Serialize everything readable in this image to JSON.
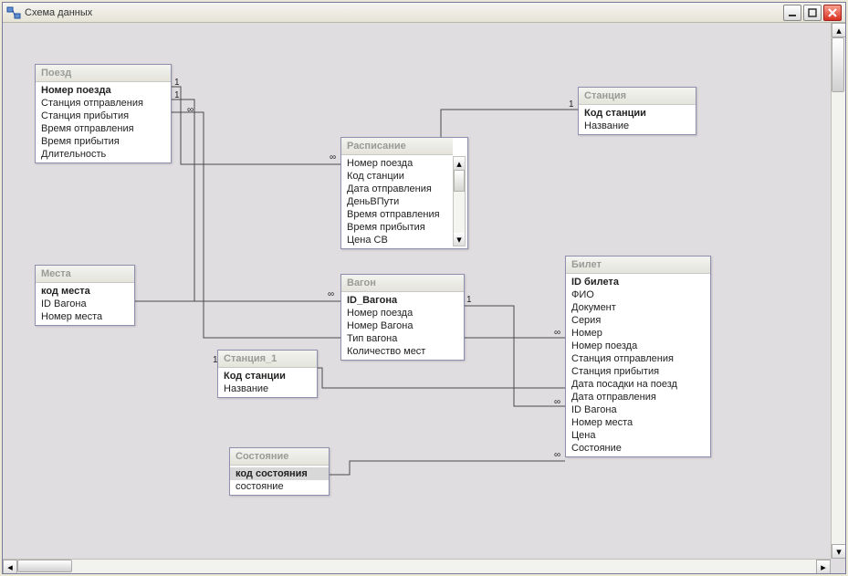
{
  "window": {
    "title": "Схема данных"
  },
  "tables": {
    "train": {
      "title": "Поезд",
      "fields": [
        "Номер поезда",
        "Станция отправления",
        "Станция прибытия",
        "Время отправления",
        "Время прибытия",
        "Длительность"
      ],
      "keys": [
        0
      ]
    },
    "station": {
      "title": "Станция",
      "fields": [
        "Код станции",
        "Название"
      ],
      "keys": [
        0
      ]
    },
    "schedule": {
      "title": "Расписание",
      "fields": [
        "Номер поезда",
        "Код станции",
        "Дата отправления",
        "ДеньВПути",
        "Время отправления",
        "Время прибытия",
        "Цена СВ"
      ],
      "keys": []
    },
    "seats": {
      "title": "Места",
      "fields": [
        "код места",
        "ID Вагона",
        "Номер места"
      ],
      "keys": [
        0
      ]
    },
    "wagon": {
      "title": "Вагон",
      "fields": [
        "ID_Вагона",
        "Номер поезда",
        "Номер Вагона",
        "Тип вагона",
        "Количество мест"
      ],
      "keys": [
        0
      ]
    },
    "station1": {
      "title": "Станция_1",
      "fields": [
        "Код станции",
        "Название"
      ],
      "keys": [
        0
      ]
    },
    "ticket": {
      "title": "Билет",
      "fields": [
        "ID билета",
        "ФИО",
        "Документ",
        "Серия",
        "Номер",
        "Номер поезда",
        "Станция отправления",
        "Станция прибытия",
        "Дата посадки на поезд",
        "Дата отправления",
        "ID Вагона",
        "Номер места",
        "Цена",
        "Состояние"
      ],
      "keys": [
        0
      ]
    },
    "state": {
      "title": "Состояние",
      "fields": [
        "код состояния",
        "состояние"
      ],
      "keys": [
        0
      ],
      "selected": [
        0
      ]
    }
  },
  "cardinality": {
    "one": "1",
    "many": "∞"
  },
  "relationships": [
    {
      "from": "train",
      "to": "schedule",
      "card": [
        "1",
        "∞"
      ]
    },
    {
      "from": "train",
      "to": "wagon",
      "card": [
        "1",
        "∞"
      ]
    },
    {
      "from": "train",
      "to": "ticket",
      "card": [
        "1",
        "∞"
      ]
    },
    {
      "from": "station",
      "to": "schedule",
      "card": [
        "1",
        "∞"
      ]
    },
    {
      "from": "station1",
      "to": "ticket",
      "card": [
        "1",
        "∞"
      ]
    },
    {
      "from": "seats",
      "to": "wagon",
      "card": [
        "∞",
        "1"
      ]
    },
    {
      "from": "wagon",
      "to": "ticket",
      "card": [
        "1",
        "∞"
      ]
    },
    {
      "from": "state",
      "to": "ticket",
      "card": [
        "1",
        "∞"
      ]
    }
  ]
}
